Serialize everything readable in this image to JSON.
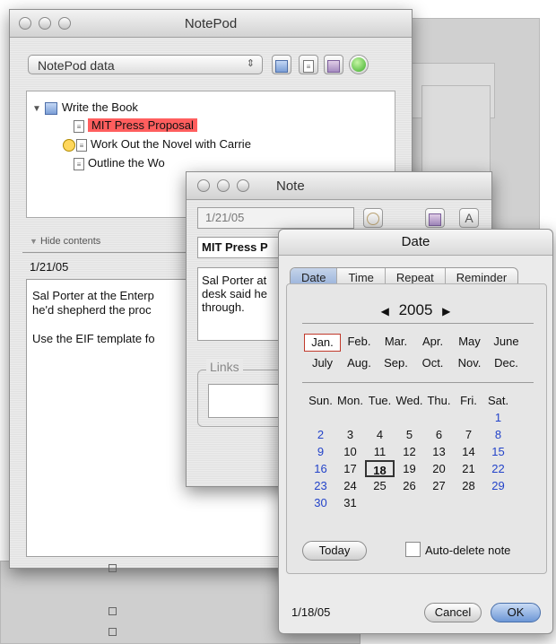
{
  "main_window": {
    "title": "NotePod",
    "source_popup": "NotePod data",
    "tree": [
      {
        "label": "Write the Book"
      },
      {
        "label": "MIT Press Proposal"
      },
      {
        "label": "Work Out the Novel with Carrie"
      },
      {
        "label": "Outline the Wo"
      }
    ],
    "hide_contents": "Hide contents",
    "detail_date": "1/21/05",
    "body_line1": "Sal Porter at the Enterp",
    "body_line2": "he'd shepherd the proc",
    "body_line3": "Use the EIF template fo"
  },
  "note_window": {
    "title": "Note",
    "date": "1/21/05",
    "heading": "MIT Press P",
    "text_line1": "Sal Porter at",
    "text_line2": "desk said he",
    "text_line3": "through.",
    "links_label": "Links",
    "font_button": "A"
  },
  "date_panel": {
    "title": "Date",
    "tabs": [
      "Date",
      "Time",
      "Repeat",
      "Reminder"
    ],
    "active_tab": "Date",
    "year": "2005",
    "prev_arrow": "◀",
    "next_arrow": "▶",
    "months": [
      "Jan.",
      "Feb.",
      "Mar.",
      "Apr.",
      "May",
      "June",
      "July",
      "Aug.",
      "Sep.",
      "Oct.",
      "Nov.",
      "Dec."
    ],
    "selected_month": "Jan.",
    "weekdays": [
      "Sun.",
      "Mon.",
      "Tue.",
      "Wed.",
      "Thu.",
      "Fri.",
      "Sat."
    ],
    "days": [
      [
        "",
        "",
        "",
        "",
        "",
        "",
        "1"
      ],
      [
        "2",
        "3",
        "4",
        "5",
        "6",
        "7",
        "8"
      ],
      [
        "9",
        "10",
        "11",
        "12",
        "13",
        "14",
        "15"
      ],
      [
        "16",
        "17",
        "18",
        "19",
        "20",
        "21",
        "22"
      ],
      [
        "23",
        "24",
        "25",
        "26",
        "27",
        "28",
        "29"
      ],
      [
        "30",
        "31",
        "",
        "",
        "",
        "",
        ""
      ]
    ],
    "selected_day": "18",
    "today_button": "Today",
    "auto_delete_label": "Auto-delete note",
    "status_date": "1/18/05",
    "cancel_button": "Cancel",
    "ok_button": "OK"
  }
}
